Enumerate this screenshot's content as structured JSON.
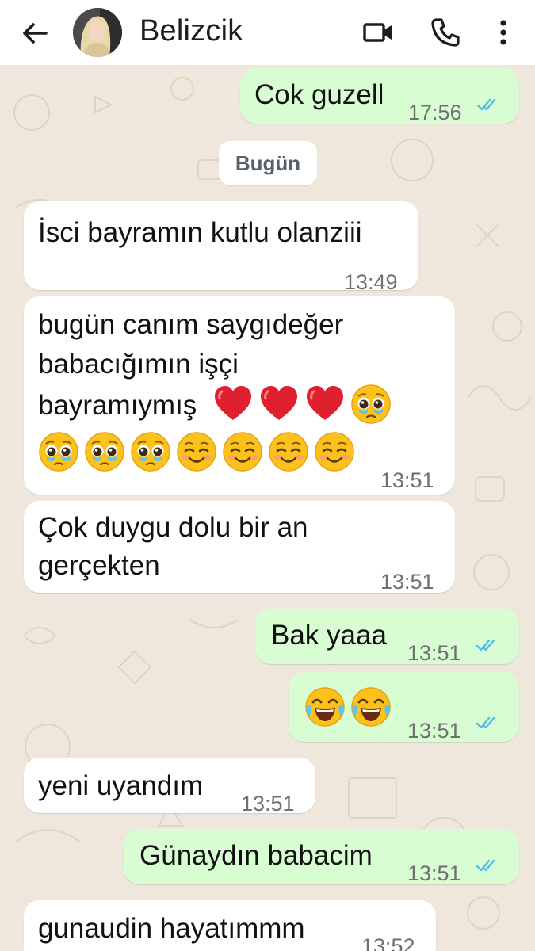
{
  "header": {
    "contact_name": "Belizcik",
    "icons": [
      "back-arrow-icon",
      "video-call-icon",
      "phone-icon",
      "more-vert-icon"
    ]
  },
  "date_divider": "Bugün",
  "messages": [
    {
      "direction": "out",
      "text": "Cok guzell",
      "time": "17:56",
      "status": "read"
    },
    {
      "direction": "in",
      "text": "İsci bayramın kutlu olanziii",
      "time": "13:49"
    },
    {
      "direction": "in",
      "text_line1": "bugün canım saygıdeğer",
      "text_line2": "babacığımın işçi",
      "text_line3": "bayramıymış",
      "emojis_line3": [
        "red-heart",
        "red-heart",
        "red-heart",
        "pleading-face"
      ],
      "emojis_line4": [
        "pleading-face",
        "pleading-face",
        "pleading-face",
        "smiling-face",
        "smiling-face",
        "smiling-face",
        "smiling-face"
      ],
      "time": "13:51"
    },
    {
      "direction": "in",
      "text_line1": "Çok duygu dolu bir an",
      "text_line2": "gerçekten",
      "time": "13:51"
    },
    {
      "direction": "out",
      "text": "Bak yaaa",
      "time": "13:51",
      "status": "read"
    },
    {
      "direction": "out",
      "emojis": [
        "tears-of-joy",
        "tears-of-joy"
      ],
      "time": "13:51",
      "status": "read"
    },
    {
      "direction": "in",
      "text": "yeni uyandım",
      "time": "13:51"
    },
    {
      "direction": "out",
      "text": "Günaydın babacim",
      "time": "13:51",
      "status": "read"
    },
    {
      "direction": "in",
      "text": "gunaudin hayatımmm",
      "time": "13:52"
    }
  ],
  "colors": {
    "incoming_bubble": "#ffffff",
    "outgoing_bubble": "#d9fdd3",
    "read_ticks": "#53bdeb",
    "chat_background": "#efe7dc"
  }
}
